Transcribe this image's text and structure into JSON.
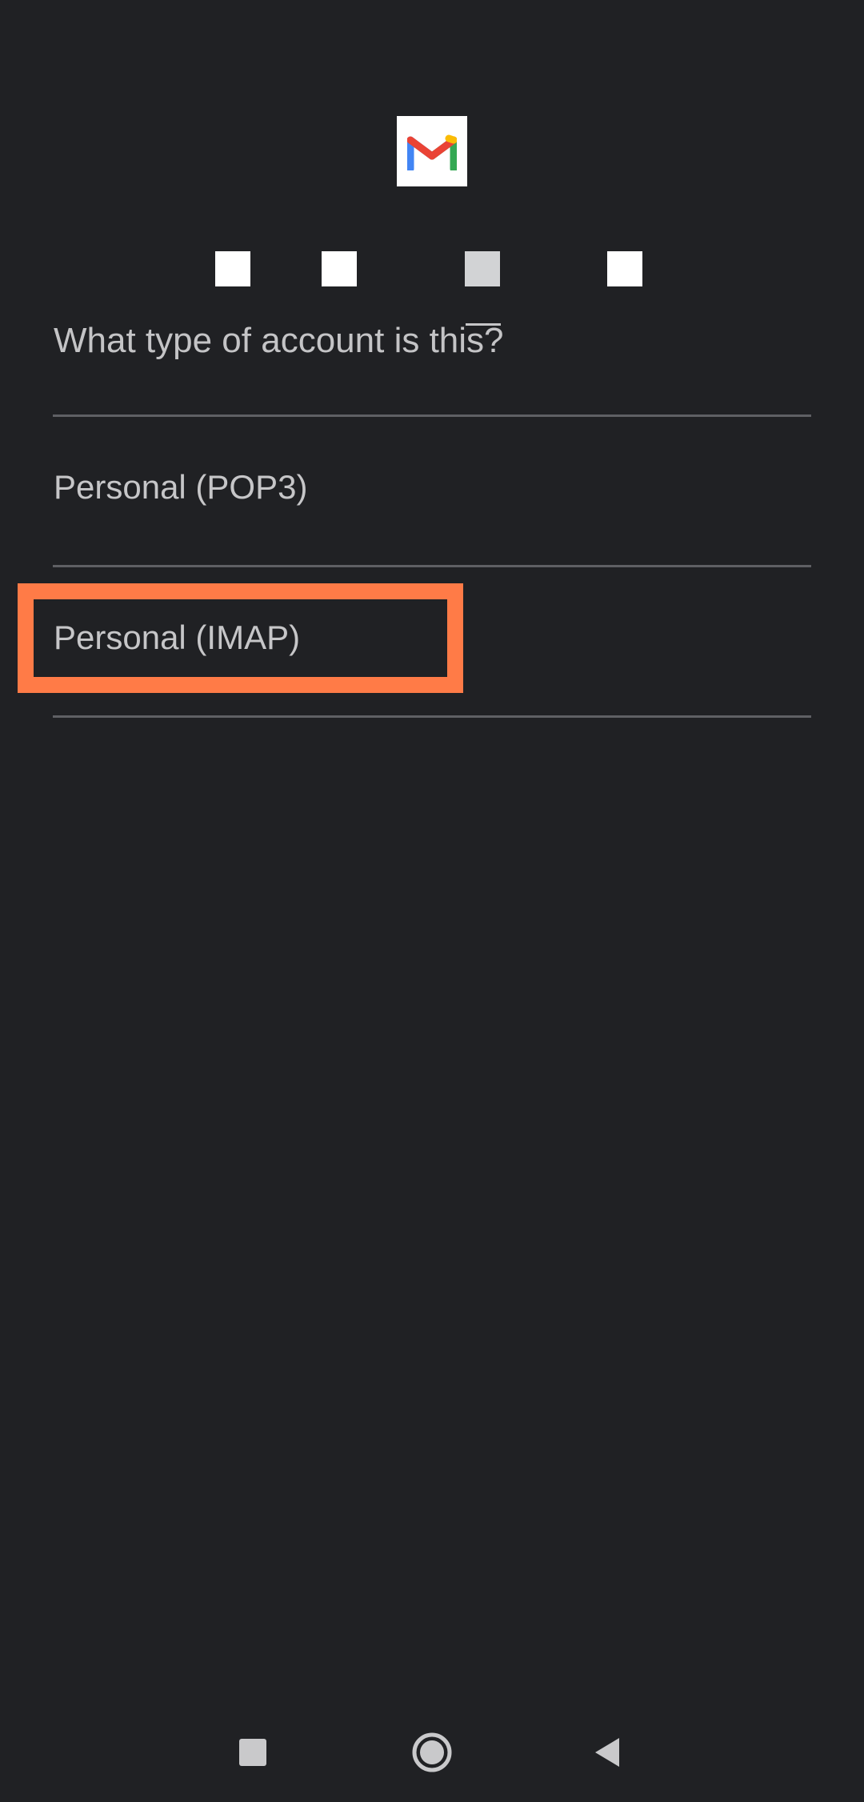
{
  "header": {
    "logo_icon": "gmail-logo-icon",
    "brand_colors": {
      "red": "#EA4335",
      "blue": "#4285F4",
      "green": "#34A853",
      "yellow": "#FBBC04"
    }
  },
  "progress": {
    "steps": 4
  },
  "main": {
    "question": "What type of account is this?",
    "options": [
      {
        "label": "Personal (POP3)"
      },
      {
        "label": "Personal (IMAP)"
      }
    ]
  },
  "annotation": {
    "highlight_color": "#FF7B47",
    "highlighted_option": "Personal (IMAP)"
  },
  "nav_bar": {
    "recents_icon": "square-recents-icon",
    "home_icon": "circle-home-icon",
    "back_icon": "triangle-back-icon"
  },
  "theme": {
    "background": "#202124",
    "text": "#C6C6C8",
    "divider": "#5F6064"
  }
}
